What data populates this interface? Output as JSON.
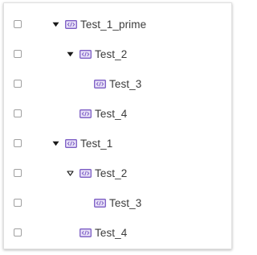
{
  "tree": {
    "rows": [
      {
        "label": "Test_1_prime",
        "expanded": true,
        "toggle": "filled",
        "depth": 0
      },
      {
        "label": "Test_2",
        "expanded": true,
        "toggle": "filled",
        "depth": 1
      },
      {
        "label": "Test_3",
        "expanded": false,
        "toggle": "none",
        "depth": 2
      },
      {
        "label": "Test_4",
        "expanded": false,
        "toggle": "none",
        "depth": 1
      },
      {
        "label": "Test_1",
        "expanded": true,
        "toggle": "filled",
        "depth": 0
      },
      {
        "label": "Test_2",
        "expanded": true,
        "toggle": "outline",
        "depth": 1
      },
      {
        "label": "Test_3",
        "expanded": false,
        "toggle": "none",
        "depth": 2
      },
      {
        "label": "Test_4",
        "expanded": false,
        "toggle": "none",
        "depth": 1
      }
    ],
    "item_icon": "code-module-icon",
    "toggle_icon": "caret-down-icon"
  },
  "colors": {
    "icon_purple": "#7b5cc4",
    "icon_fill": "#e9e2f8",
    "text": "#3c3c3c",
    "checkbox_border": "#a0a0a0"
  }
}
